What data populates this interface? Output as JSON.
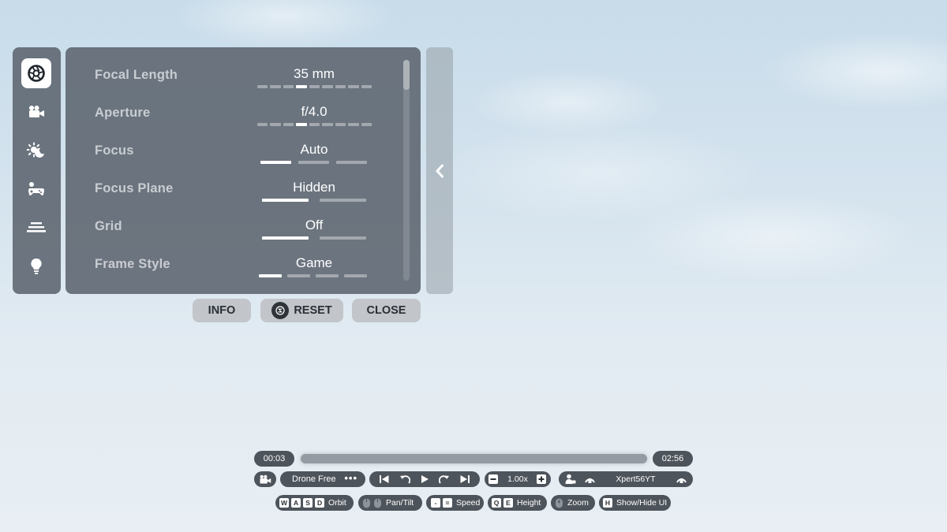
{
  "sidebar": {
    "items": [
      {
        "icon": "aperture-icon",
        "active": true
      },
      {
        "icon": "video-camera-icon",
        "active": false
      },
      {
        "icon": "weather-icon",
        "active": false
      },
      {
        "icon": "gamepad-icon",
        "active": false
      },
      {
        "icon": "layers-icon",
        "active": false
      },
      {
        "icon": "lightbulb-icon",
        "active": false
      }
    ]
  },
  "settings": {
    "rows": [
      {
        "label": "Focal Length",
        "value": "35 mm",
        "control": "ticks",
        "steps": 9,
        "selected_index": 3
      },
      {
        "label": "Aperture",
        "value": "f/4.0",
        "control": "ticks",
        "steps": 9,
        "selected_index": 3
      },
      {
        "label": "Focus",
        "value": "Auto",
        "control": "segments",
        "options": 3,
        "selected_index": 0
      },
      {
        "label": "Focus Plane",
        "value": "Hidden",
        "control": "segments",
        "options": 2,
        "selected_index": 0
      },
      {
        "label": "Grid",
        "value": "Off",
        "control": "segments",
        "options": 2,
        "selected_index": 0
      },
      {
        "label": "Frame Style",
        "value": "Game",
        "control": "segments",
        "options": 4,
        "selected_index": 0
      }
    ]
  },
  "actions": {
    "info_label": "INFO",
    "reset_label": "RESET",
    "close_label": "CLOSE"
  },
  "playback": {
    "current_time": "00:03",
    "total_time": "02:56",
    "camera_mode": "Drone Free",
    "speed": "1.00x",
    "player_name": "Xpert56YT"
  },
  "hints": {
    "orbit_keys": [
      "W",
      "A",
      "S",
      "D"
    ],
    "orbit_label": "Orbit",
    "pan_label": "Pan/Tilt",
    "speed_keys": [
      "-",
      "="
    ],
    "speed_label": "Speed",
    "height_keys": [
      "Q",
      "E"
    ],
    "height_label": "Height",
    "zoom_label": "Zoom",
    "ui_key": "H",
    "ui_label": "Show/Hide UI"
  },
  "colors": {
    "panel": "#5c646e",
    "active_tab": "#ffffff",
    "inactive_track": "#a2a8ae",
    "button": "#c2c6cb",
    "hud_pill": "#4e545b"
  }
}
